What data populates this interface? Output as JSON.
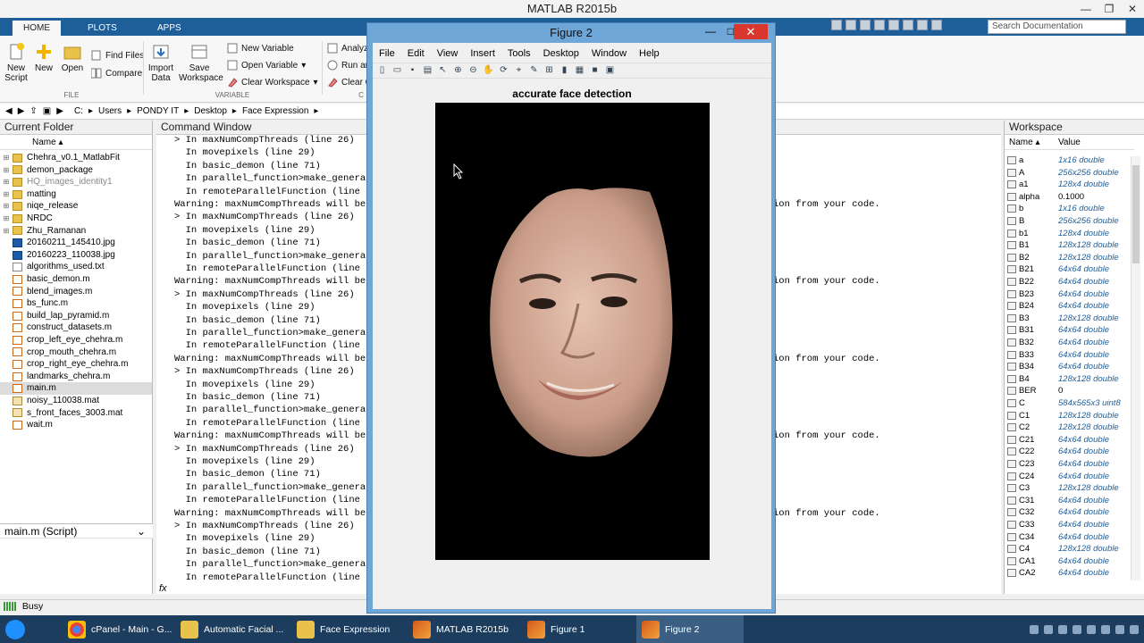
{
  "window": {
    "title": "MATLAB R2015b"
  },
  "ribbon": {
    "tabs": [
      "HOME",
      "PLOTS",
      "APPS"
    ],
    "buttons": {
      "new_script": "New Script",
      "new": "New",
      "open": "Open",
      "find_files": "Find Files",
      "compare": "Compare",
      "import_data": "Import Data",
      "save_workspace": "Save Workspace",
      "new_variable": "New Variable",
      "open_variable": "Open Variable",
      "clear_workspace": "Clear Workspace",
      "analyze": "Analyz",
      "run_and": "Run an",
      "clear_c": "Clear C"
    },
    "groups": {
      "file": "FILE",
      "variable": "VARIABLE",
      "code": "C"
    },
    "search_placeholder": "Search Documentation"
  },
  "address": {
    "path": [
      "C:",
      "Users",
      "PONDY IT",
      "Desktop",
      "Face Expression"
    ]
  },
  "current_folder": {
    "title": "Current Folder",
    "col_name": "Name",
    "items": [
      {
        "name": "Chehra_v0.1_MatlabFit",
        "type": "folder"
      },
      {
        "name": "demon_package",
        "type": "folder"
      },
      {
        "name": "HQ_images_identity1",
        "type": "folder"
      },
      {
        "name": "matting",
        "type": "folder"
      },
      {
        "name": "niqe_release",
        "type": "folder"
      },
      {
        "name": "NRDC",
        "type": "folder"
      },
      {
        "name": "Zhu_Ramanan",
        "type": "folder"
      },
      {
        "name": "20160211_145410.jpg",
        "type": "ps"
      },
      {
        "name": "20160223_110038.jpg",
        "type": "ps"
      },
      {
        "name": "algorithms_used.txt",
        "type": "file"
      },
      {
        "name": "basic_demon.m",
        "type": "m"
      },
      {
        "name": "blend_images.m",
        "type": "m"
      },
      {
        "name": "bs_func.m",
        "type": "m"
      },
      {
        "name": "build_lap_pyramid.m",
        "type": "m"
      },
      {
        "name": "construct_datasets.m",
        "type": "m"
      },
      {
        "name": "crop_left_eye_chehra.m",
        "type": "m"
      },
      {
        "name": "crop_mouth_chehra.m",
        "type": "m"
      },
      {
        "name": "crop_right_eye_chehra.m",
        "type": "m"
      },
      {
        "name": "landmarks_chehra.m",
        "type": "m"
      },
      {
        "name": "main.m",
        "type": "m"
      },
      {
        "name": "noisy_110038.mat",
        "type": "mat"
      },
      {
        "name": "s_front_faces_3003.mat",
        "type": "mat"
      },
      {
        "name": "wait.m",
        "type": "m"
      }
    ],
    "details": "main.m  (Script)"
  },
  "command_window": {
    "title": "Command Window",
    "lines": [
      "> In maxNumCompThreads (line 26)",
      "  In movepixels (line 29)",
      "  In basic_demon (line 71)",
      "  In parallel_function>make_genera",
      "  In remoteParallelFunction (line",
      "Warning: maxNumCompThreads will be",
      "> In maxNumCompThreads (line 26)",
      "  In movepixels (line 29)",
      "  In basic_demon (line 71)",
      "  In parallel_function>make_genera",
      "  In remoteParallelFunction (line",
      "Warning: maxNumCompThreads will be",
      "> In maxNumCompThreads (line 26)",
      "  In movepixels (line 29)",
      "  In basic_demon (line 71)",
      "  In parallel_function>make_genera",
      "  In remoteParallelFunction (line",
      "Warning: maxNumCompThreads will be",
      "> In maxNumCompThreads (line 26)",
      "  In movepixels (line 29)",
      "  In basic_demon (line 71)",
      "  In parallel_function>make_genera",
      "  In remoteParallelFunction (line",
      "Warning: maxNumCompThreads will be",
      "> In maxNumCompThreads (line 26)",
      "  In movepixels (line 29)",
      "  In basic_demon (line 71)",
      "  In parallel_function>make_genera",
      "  In remoteParallelFunction (line",
      "Warning: maxNumCompThreads will be",
      "> In maxNumCompThreads (line 26)",
      "  In movepixels (line 29)",
      "  In basic_demon (line 71)",
      "  In parallel_function>make_genera",
      "  In remoteParallelFunction (line"
    ],
    "right_fragment": "ion from your code.",
    "prompt": "fx"
  },
  "workspace": {
    "title": "Workspace",
    "col_name": "Name",
    "col_value": "Value",
    "vars": [
      {
        "name": "a",
        "value": "1x16 double",
        "plain": false
      },
      {
        "name": "A",
        "value": "256x256 double",
        "plain": false
      },
      {
        "name": "a1",
        "value": "128x4 double",
        "plain": false
      },
      {
        "name": "alpha",
        "value": "0.1000",
        "plain": true
      },
      {
        "name": "b",
        "value": "1x16 double",
        "plain": false
      },
      {
        "name": "B",
        "value": "256x256 double",
        "plain": false
      },
      {
        "name": "b1",
        "value": "128x4 double",
        "plain": false
      },
      {
        "name": "B1",
        "value": "128x128 double",
        "plain": false
      },
      {
        "name": "B2",
        "value": "128x128 double",
        "plain": false
      },
      {
        "name": "B21",
        "value": "64x64 double",
        "plain": false
      },
      {
        "name": "B22",
        "value": "64x64 double",
        "plain": false
      },
      {
        "name": "B23",
        "value": "64x64 double",
        "plain": false
      },
      {
        "name": "B24",
        "value": "64x64 double",
        "plain": false
      },
      {
        "name": "B3",
        "value": "128x128 double",
        "plain": false
      },
      {
        "name": "B31",
        "value": "64x64 double",
        "plain": false
      },
      {
        "name": "B32",
        "value": "64x64 double",
        "plain": false
      },
      {
        "name": "B33",
        "value": "64x64 double",
        "plain": false
      },
      {
        "name": "B34",
        "value": "64x64 double",
        "plain": false
      },
      {
        "name": "B4",
        "value": "128x128 double",
        "plain": false
      },
      {
        "name": "BER",
        "value": "0",
        "plain": true
      },
      {
        "name": "C",
        "value": "584x565x3 uint8",
        "plain": false
      },
      {
        "name": "C1",
        "value": "128x128 double",
        "plain": false
      },
      {
        "name": "C2",
        "value": "128x128 double",
        "plain": false
      },
      {
        "name": "C21",
        "value": "64x64 double",
        "plain": false
      },
      {
        "name": "C22",
        "value": "64x64 double",
        "plain": false
      },
      {
        "name": "C23",
        "value": "64x64 double",
        "plain": false
      },
      {
        "name": "C24",
        "value": "64x64 double",
        "plain": false
      },
      {
        "name": "C3",
        "value": "128x128 double",
        "plain": false
      },
      {
        "name": "C31",
        "value": "64x64 double",
        "plain": false
      },
      {
        "name": "C32",
        "value": "64x64 double",
        "plain": false
      },
      {
        "name": "C33",
        "value": "64x64 double",
        "plain": false
      },
      {
        "name": "C34",
        "value": "64x64 double",
        "plain": false
      },
      {
        "name": "C4",
        "value": "128x128 double",
        "plain": false
      },
      {
        "name": "CA1",
        "value": "64x64 double",
        "plain": false
      },
      {
        "name": "CA2",
        "value": "64x64 double",
        "plain": false
      }
    ]
  },
  "status": {
    "text": "Busy"
  },
  "figure": {
    "title": "Figure 2",
    "menu": [
      "File",
      "Edit",
      "View",
      "Insert",
      "Tools",
      "Desktop",
      "Window",
      "Help"
    ],
    "axes_title": "accurate face detection"
  },
  "taskbar": {
    "items": [
      "cPanel - Main - G...",
      "Automatic Facial ...",
      "Face Expression",
      "MATLAB R2015b",
      "Figure 1",
      "Figure 2"
    ]
  },
  "colors": {
    "ribbon_blue": "#1f5f99",
    "taskbar": "#1c3d5d",
    "close_red": "#d9372d"
  }
}
